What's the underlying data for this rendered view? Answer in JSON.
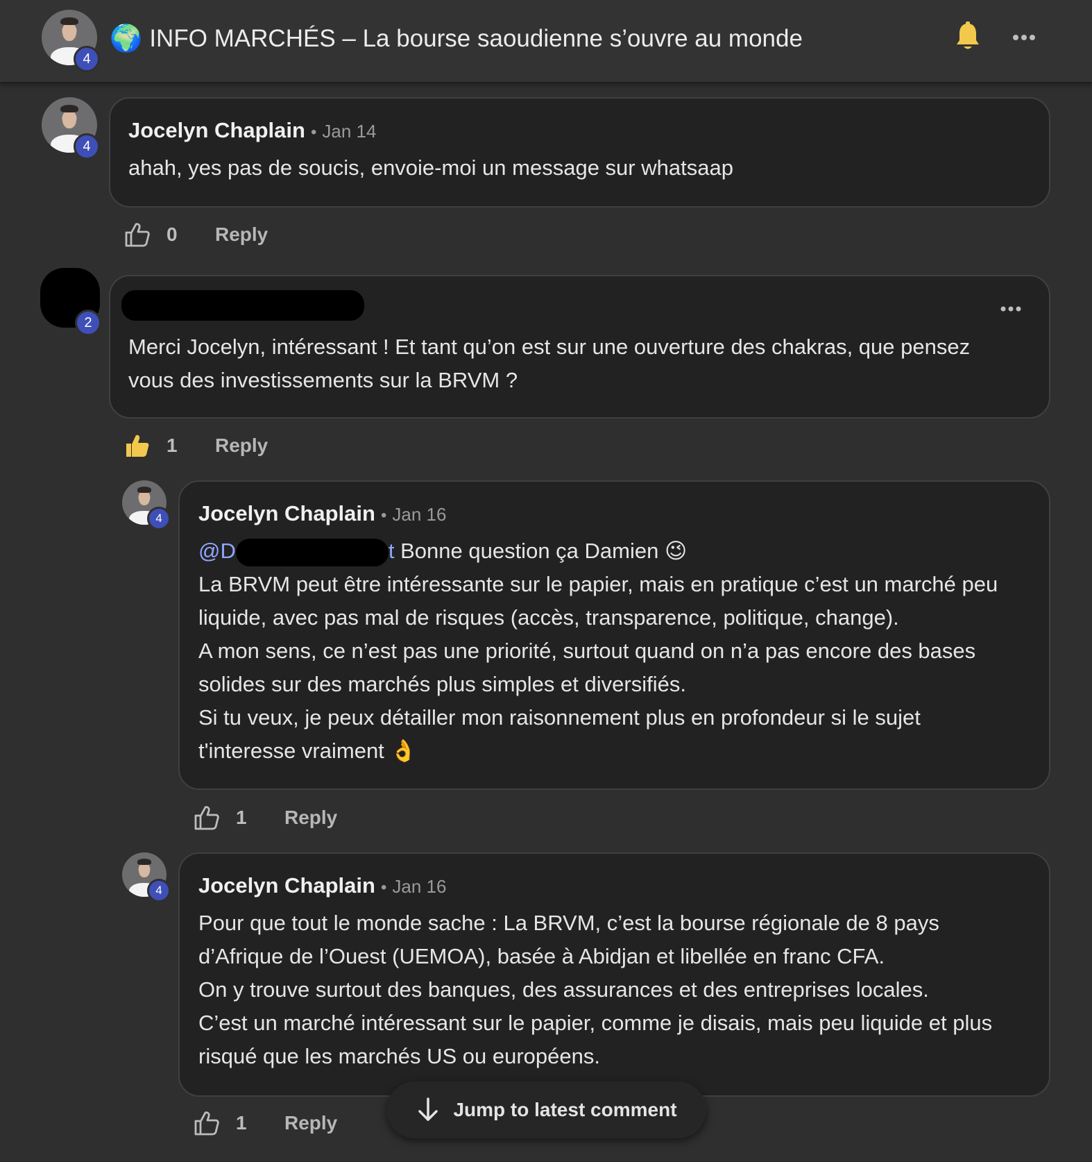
{
  "header": {
    "badge": "4",
    "globe_icon": "🌍",
    "title": "INFO MARCHÉS – La bourse saoudienne s’ouvre au monde",
    "bell_icon": "bell-icon",
    "more_icon": "more-icon"
  },
  "comments": [
    {
      "badge": "4",
      "author": "Jocelyn Chaplain",
      "date": "Jan 14",
      "lines": [
        "ahah, yes pas de soucis, envoie-moi un message sur whatsaap"
      ],
      "likes": "0",
      "reply": "Reply"
    },
    {
      "badge": "2",
      "author": "",
      "date": "",
      "lines": [
        "Merci Jocelyn, intéressant ! Et tant qu’on est sur une ouverture des chakras, que pensez",
        "vous des investissements sur la BRVM ?"
      ],
      "likes": "1",
      "reply": "Reply"
    },
    {
      "badge": "4",
      "author": "Jocelyn Chaplain",
      "date": "Jan 16",
      "mention_start": "@D",
      "mention_end": "t",
      "first_line_rest": " Bonne question ça Damien ",
      "wink_emoji": "😉",
      "lines": [
        "La BRVM peut être intéressante sur le papier, mais en pratique c’est un marché peu",
        "liquide, avec pas mal de risques (accès, transparence, politique, change).",
        "A mon sens, ce n’est pas une priorité, surtout quand on n’a pas encore des bases",
        "solides sur des marchés plus simples et diversifiés.",
        "Si tu veux, je peux détailler mon raisonnement plus en profondeur si le sujet",
        "t'interesse vraiment "
      ],
      "ok_emoji": "👌",
      "likes": "1",
      "reply": "Reply"
    },
    {
      "badge": "4",
      "author": "Jocelyn Chaplain",
      "date": "Jan 16",
      "lines": [
        "Pour que tout le monde sache : La BRVM, c’est la bourse régionale de 8 pays",
        "d’Afrique de l’Ouest (UEMOA), basée à Abidjan et libellée en franc CFA.",
        "On y trouve surtout des banques, des assurances et des entreprises locales.",
        "C’est un marché intéressant sur le papier, comme je disais, mais peu liquide et plus",
        "risqué que les marchés US ou européens."
      ],
      "likes": "1",
      "reply": "Reply"
    }
  ],
  "jump": {
    "label": "Jump to latest comment"
  },
  "colors": {
    "background": "#2f2f30",
    "bubble": "#222223",
    "badge": "#3f4fb8",
    "mention": "#8ea7ff",
    "bell": "#f2c94c"
  }
}
